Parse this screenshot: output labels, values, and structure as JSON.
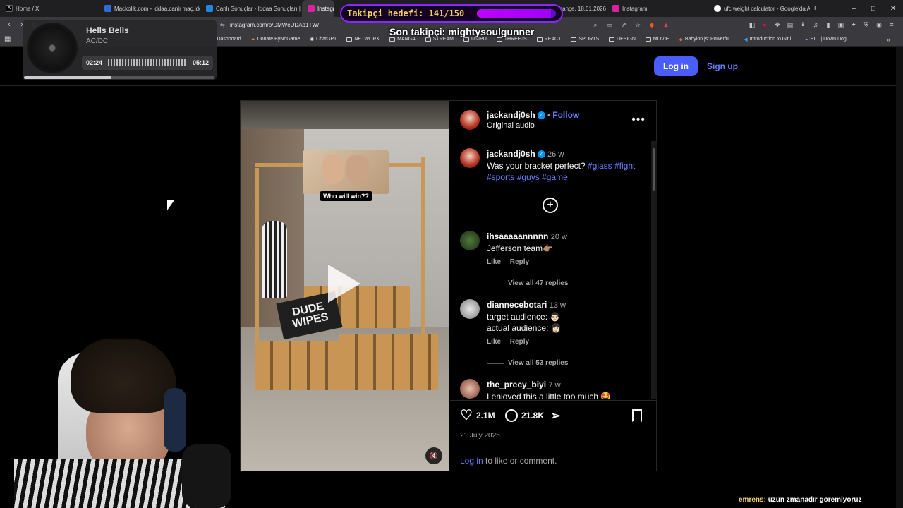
{
  "tabs": [
    {
      "label": "Home / X",
      "color": "#000000"
    },
    {
      "label": "Mackolik.com - iddaa,canlı maç,iddaa",
      "color": "#2b6fd6"
    },
    {
      "label": "Canlı Sonuçlar - İddaa Sonuçları | Ma",
      "color": "#1e88e5"
    },
    {
      "label": "Instagram",
      "color": "#d6249f"
    },
    {
      "label": "",
      "color": "#888888"
    },
    {
      "label": "rbahçe, 18.01.2026",
      "color": "#444444"
    },
    {
      "label": "Instagram",
      "color": "#d6249f"
    },
    {
      "label": "ufc weight calculator - Google'da Ara",
      "color": "#ffffff"
    },
    {
      "label": "+",
      "color": ""
    }
  ],
  "window_controls": [
    "–",
    "□",
    "✕"
  ],
  "address": {
    "url": "instagram.com/p/DMWeUDAo1TW/"
  },
  "bookmarks": [
    {
      "label": "Dashboard",
      "type": "plain"
    },
    {
      "label": "Donate ByNoGame",
      "type": "plain"
    },
    {
      "label": "ChatGPT",
      "type": "plain"
    },
    {
      "label": "NETWORK",
      "type": "folder"
    },
    {
      "label": "MANGA",
      "type": "folder"
    },
    {
      "label": "STREAM",
      "type": "folder"
    },
    {
      "label": "UNIPD",
      "type": "folder"
    },
    {
      "label": "THREEJS",
      "type": "folder"
    },
    {
      "label": "REACT",
      "type": "folder"
    },
    {
      "label": "SPORTS",
      "type": "folder"
    },
    {
      "label": "DESIGN",
      "type": "folder"
    },
    {
      "label": "MOVIE",
      "type": "folder"
    },
    {
      "label": "Babylon.js: Powerful...",
      "type": "plain"
    },
    {
      "label": "Introduction to Git i...",
      "type": "plain"
    },
    {
      "label": "HIIT | Down Dog",
      "type": "plain"
    }
  ],
  "overlay": {
    "goal_label": "Takipçi hedefi: 141/150",
    "goal_progress": 0.94,
    "last_follower": "Son takipçi: mightysoulgunner",
    "music": {
      "title": "Hells Bells",
      "artist": "AC/DC",
      "elapsed": "02:24",
      "total": "05:12",
      "progress": 0.46
    },
    "chat": {
      "user": "emrens:",
      "message": "uzun zmanadır göremiyoruz"
    }
  },
  "header": {
    "logo_fragment": "m",
    "login": "Log in",
    "signup": "Sign up"
  },
  "post": {
    "author": "jackandj0sh",
    "follow": "Follow",
    "audio": "Original audio",
    "video_caption_overlay": "Who will win??",
    "video_sign": "DUDE WIPES",
    "caption": {
      "user": "jackandj0sh",
      "time": "26 w",
      "text": "Was your bracket perfect?",
      "tags": [
        "#glass",
        "#fight",
        "#sports",
        "#guys",
        "#game"
      ]
    },
    "comments": [
      {
        "user": "ihsaaaaannnnn",
        "time": "20 w",
        "lines": [
          "Jefferson team👉🏽"
        ],
        "like": "Like",
        "reply": "Reply",
        "view_all": "View all 47 replies"
      },
      {
        "user": "diannecebotari",
        "time": "13 w",
        "lines": [
          "target audience: 👨🏻",
          "actual audience: 👩🏻"
        ],
        "like": "Like",
        "reply": "Reply",
        "view_all": "View all 53 replies"
      },
      {
        "user": "the_precy_biyi",
        "time": "7 w",
        "lines": [
          "I enjoyed this a little too much 🤩"
        ]
      }
    ],
    "likes": "2.1M",
    "comment_count": "21.8K",
    "date": "21 July 2025",
    "login_prompt_link": "Log in",
    "login_prompt_text": "to like or comment."
  }
}
